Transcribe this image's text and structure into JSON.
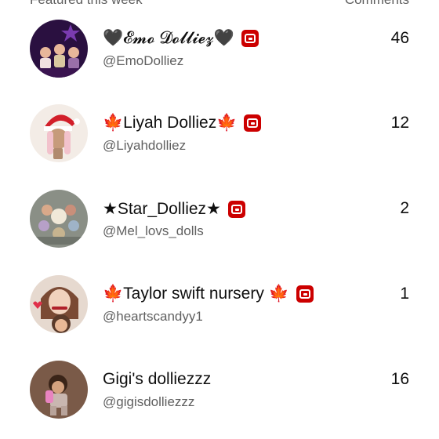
{
  "header": {
    "left_label": "Featured this week",
    "right_label": "Comments"
  },
  "channels": [
    {
      "name": "🖤𝓔𝓶𝓸 𝓓𝓸𝓵𝓵𝓲𝓮𝔃🖤",
      "handle": "@EmoDolliez",
      "count": "46",
      "badge": true
    },
    {
      "name": "🍁Liyah Dolliez🍁",
      "handle": "@Liyahdolliez",
      "count": "12",
      "badge": true
    },
    {
      "name": "★Star_Dolliez★",
      "handle": "@Mel_lovs_dolls",
      "count": "2",
      "badge": true
    },
    {
      "name": "🍁Taylor swift nursery 🍁",
      "handle": "@heartscandyy1",
      "count": "1",
      "badge": true
    },
    {
      "name": "Gigi's dolliezzz",
      "handle": "@gigisdolliezzz",
      "count": "16",
      "badge": false
    }
  ]
}
